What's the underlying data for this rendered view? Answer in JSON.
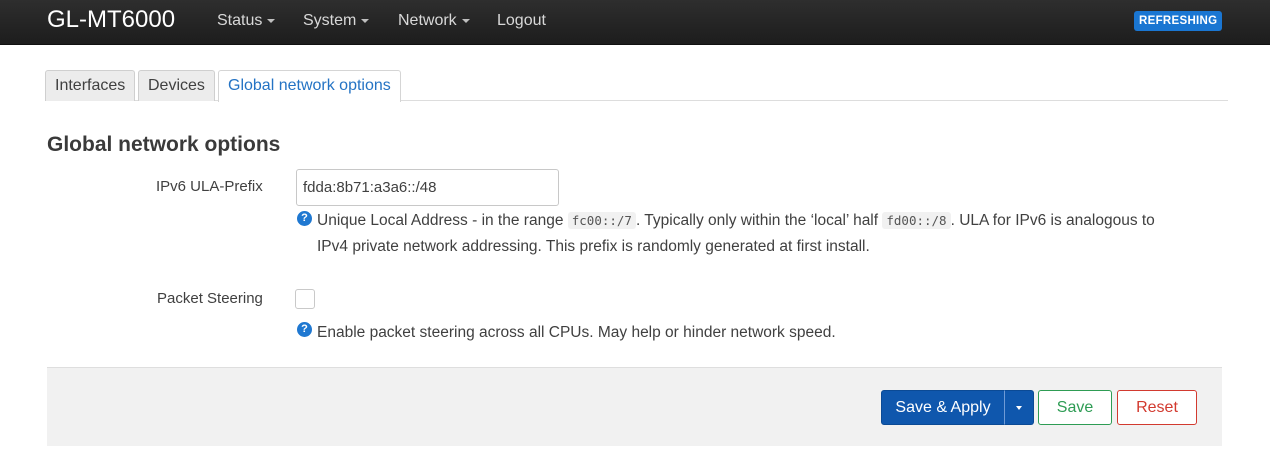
{
  "navbar": {
    "brand": "GL-MT6000",
    "items": [
      {
        "label": "Status",
        "has_dropdown": true
      },
      {
        "label": "System",
        "has_dropdown": true
      },
      {
        "label": "Network",
        "has_dropdown": true
      },
      {
        "label": "Logout",
        "has_dropdown": false
      }
    ],
    "badge": "REFRESHING",
    "colors": {
      "background": "#232323",
      "badge": "#1a76d2"
    }
  },
  "tabs": [
    {
      "label": "Interfaces",
      "active": false
    },
    {
      "label": "Devices",
      "active": false
    },
    {
      "label": "Global network options",
      "active": true
    }
  ],
  "section": {
    "title": "Global network options",
    "fields": {
      "ula_prefix": {
        "label": "IPv6 ULA-Prefix",
        "value": "fdda:8b71:a3a6::/48",
        "help": {
          "part1": "Unique Local Address - in the range ",
          "code1": "fc00::/7",
          "part2": ". Typically only within the ‘local’ half ",
          "code2": "fd00::/8",
          "part3": ". ULA for IPv6 is analogous to",
          "line2": "IPv4 private network addressing. This prefix is randomly generated at first install."
        }
      },
      "packet_steering": {
        "label": "Packet Steering",
        "checked": false,
        "help": "Enable packet steering across all CPUs. May help or hinder network speed."
      }
    }
  },
  "actions": {
    "save_apply": "Save & Apply",
    "save": "Save",
    "reset": "Reset",
    "colors": {
      "apply": "#0f57ad",
      "save": "#2e9c54",
      "reset": "#d23a2f"
    }
  },
  "icons": {
    "help": "?"
  }
}
